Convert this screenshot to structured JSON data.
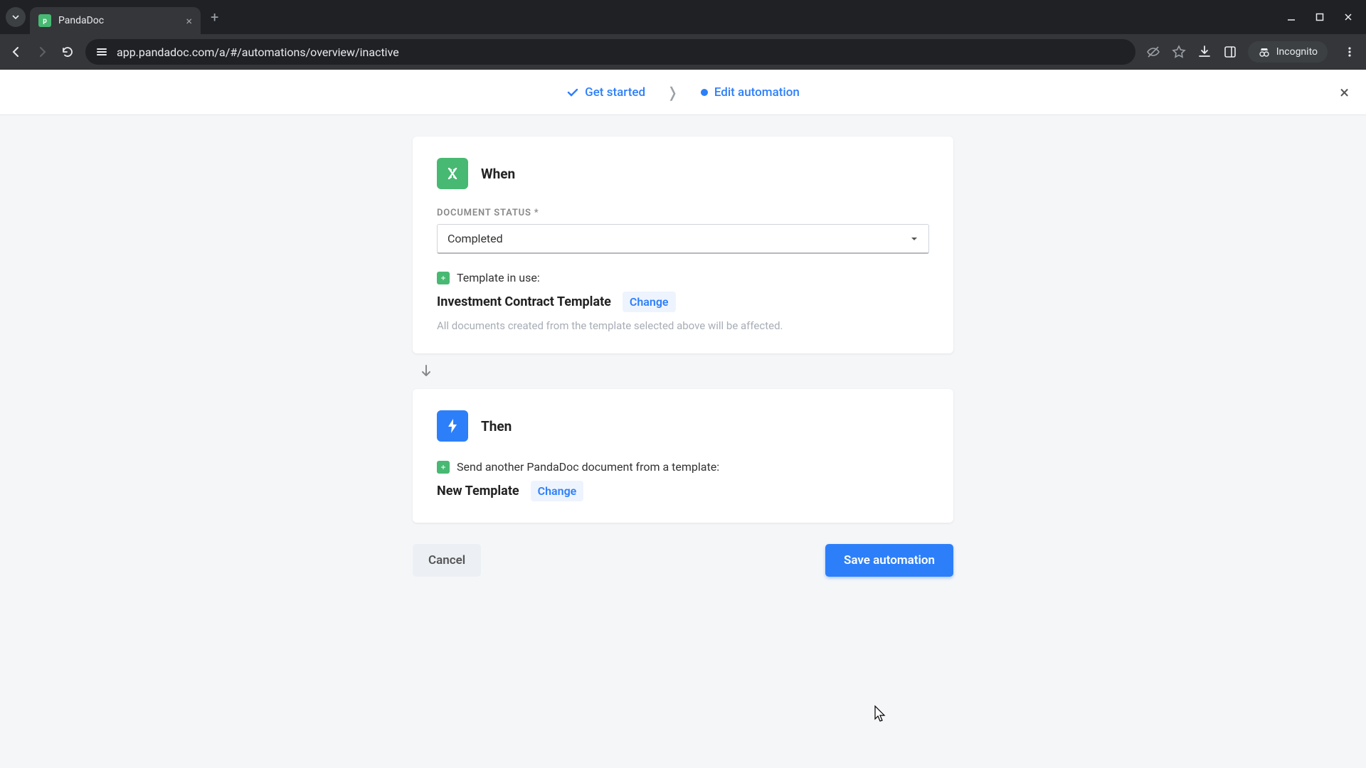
{
  "browser": {
    "tab_title": "PandaDoc",
    "url": "app.pandadoc.com/a/#/automations/overview/inactive",
    "incognito_label": "Incognito"
  },
  "stepper": {
    "step1": "Get started",
    "step2": "Edit automation"
  },
  "when": {
    "title": "When",
    "status_label": "DOCUMENT STATUS *",
    "status_value": "Completed",
    "template_label": "Template in use:",
    "template_name": "Investment Contract Template",
    "change": "Change",
    "hint": "All documents created from the template selected above will be affected."
  },
  "then": {
    "title": "Then",
    "action_label": "Send another PandaDoc document from a template:",
    "template_name": "New Template",
    "change": "Change"
  },
  "footer": {
    "cancel": "Cancel",
    "save": "Save automation"
  }
}
